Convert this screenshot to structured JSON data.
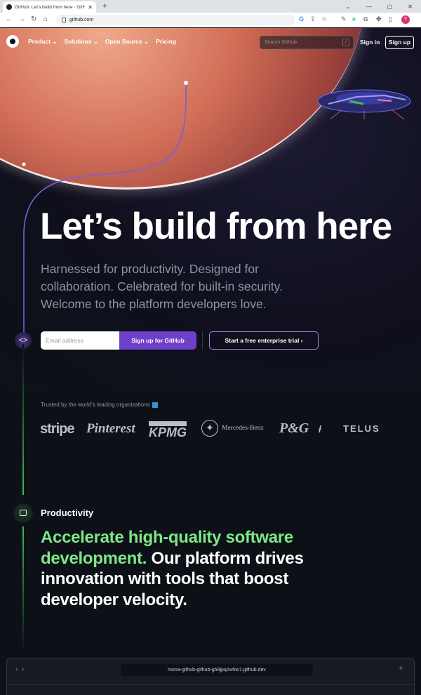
{
  "browser": {
    "tab_title": "GitHub: Let's build from here · GitHub",
    "new_tab": "+",
    "url": "github.com",
    "avatar_initial": "Y"
  },
  "nav": {
    "items": [
      "Product",
      "Solutions",
      "Open Source",
      "Pricing"
    ],
    "search_placeholder": "Search GitHub",
    "search_shortcut": "/",
    "sign_in": "Sign in",
    "sign_up": "Sign up"
  },
  "hero": {
    "title": "Let’s build from here",
    "subtitle": "Harnessed for productivity. Designed for collaboration. Celebrated for built-in security. Welcome to the platform developers love.",
    "email_placeholder": "Email address",
    "signup_button": "Sign up for GitHub",
    "enterprise_button": "Start a free enterprise trial ›"
  },
  "trusted": {
    "label": "Trusted by the world’s leading organizations",
    "logos": [
      "stripe",
      "Pinterest",
      "KPMG",
      "Mercedes-Benz",
      "P&G",
      "TELUS"
    ]
  },
  "productivity": {
    "label": "Productivity",
    "headline_green": "Accelerate high-quality software development.",
    "headline_white": " Our platform drives innovation with tools that boost developer velocity."
  },
  "editor": {
    "url": "mona-github-github-g59jpq2w5w7.github.dev"
  },
  "colors": {
    "background": "#0d1117",
    "accent_purple": "#6e40c9",
    "accent_green": "#7ee787"
  }
}
